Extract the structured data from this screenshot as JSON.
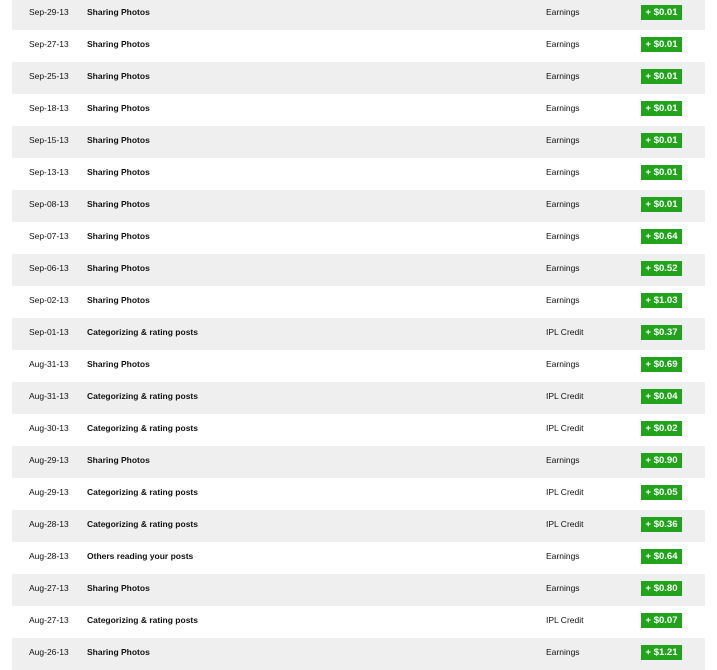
{
  "transactions": [
    {
      "date": "Sep-29-13",
      "description": "Sharing Photos",
      "type": "Earnings",
      "amount": "+ $0.01"
    },
    {
      "date": "Sep-27-13",
      "description": "Sharing Photos",
      "type": "Earnings",
      "amount": "+ $0.01"
    },
    {
      "date": "Sep-25-13",
      "description": "Sharing Photos",
      "type": "Earnings",
      "amount": "+ $0.01"
    },
    {
      "date": "Sep-18-13",
      "description": "Sharing Photos",
      "type": "Earnings",
      "amount": "+ $0.01"
    },
    {
      "date": "Sep-15-13",
      "description": "Sharing Photos",
      "type": "Earnings",
      "amount": "+ $0.01"
    },
    {
      "date": "Sep-13-13",
      "description": "Sharing Photos",
      "type": "Earnings",
      "amount": "+ $0.01"
    },
    {
      "date": "Sep-08-13",
      "description": "Sharing Photos",
      "type": "Earnings",
      "amount": "+ $0.01"
    },
    {
      "date": "Sep-07-13",
      "description": "Sharing Photos",
      "type": "Earnings",
      "amount": "+ $0.64"
    },
    {
      "date": "Sep-06-13",
      "description": "Sharing Photos",
      "type": "Earnings",
      "amount": "+ $0.52"
    },
    {
      "date": "Sep-02-13",
      "description": "Sharing Photos",
      "type": "Earnings",
      "amount": "+ $1.03"
    },
    {
      "date": "Sep-01-13",
      "description": "Categorizing & rating posts",
      "type": "IPL Credit",
      "amount": "+ $0.37"
    },
    {
      "date": "Aug-31-13",
      "description": "Sharing Photos",
      "type": "Earnings",
      "amount": "+ $0.69"
    },
    {
      "date": "Aug-31-13",
      "description": "Categorizing & rating posts",
      "type": "IPL Credit",
      "amount": "+ $0.04"
    },
    {
      "date": "Aug-30-13",
      "description": "Categorizing & rating posts",
      "type": "IPL Credit",
      "amount": "+ $0.02"
    },
    {
      "date": "Aug-29-13",
      "description": "Sharing Photos",
      "type": "Earnings",
      "amount": "+ $0.90"
    },
    {
      "date": "Aug-29-13",
      "description": "Categorizing & rating posts",
      "type": "IPL Credit",
      "amount": "+ $0.05"
    },
    {
      "date": "Aug-28-13",
      "description": "Categorizing & rating posts",
      "type": "IPL Credit",
      "amount": "+ $0.36"
    },
    {
      "date": "Aug-28-13",
      "description": "Others reading your posts",
      "type": "Earnings",
      "amount": "+ $0.64"
    },
    {
      "date": "Aug-27-13",
      "description": "Sharing Photos",
      "type": "Earnings",
      "amount": "+ $0.80"
    },
    {
      "date": "Aug-27-13",
      "description": "Categorizing & rating posts",
      "type": "IPL Credit",
      "amount": "+ $0.07"
    },
    {
      "date": "Aug-26-13",
      "description": "Sharing Photos",
      "type": "Earnings",
      "amount": "+ $1.21"
    }
  ],
  "colors": {
    "row_shaded": "#efefef",
    "row_plain": "#ffffff",
    "amount_badge": "#22a31c",
    "amount_text": "#ffffff"
  }
}
